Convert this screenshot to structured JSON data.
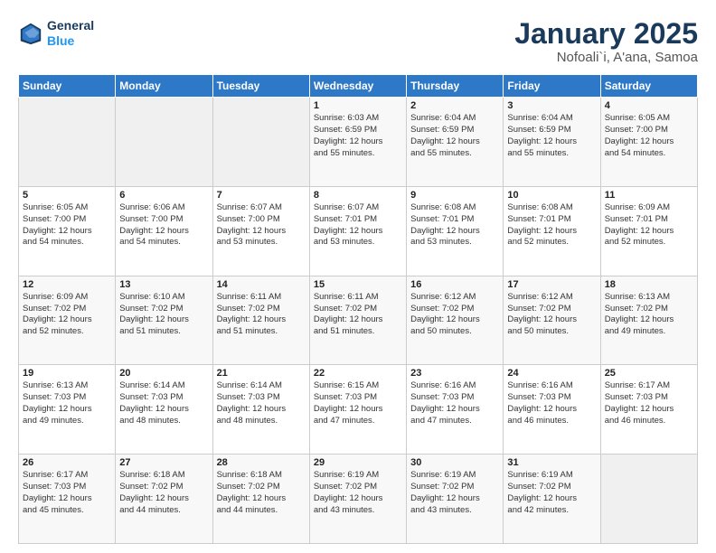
{
  "header": {
    "logo": {
      "line1": "General",
      "line2": "Blue"
    },
    "title": "January 2025",
    "subtitle": "Nofoali`i, A'ana, Samoa"
  },
  "days_of_week": [
    "Sunday",
    "Monday",
    "Tuesday",
    "Wednesday",
    "Thursday",
    "Friday",
    "Saturday"
  ],
  "weeks": [
    [
      {
        "day": "",
        "info": ""
      },
      {
        "day": "",
        "info": ""
      },
      {
        "day": "",
        "info": ""
      },
      {
        "day": "1",
        "info": "Sunrise: 6:03 AM\nSunset: 6:59 PM\nDaylight: 12 hours\nand 55 minutes."
      },
      {
        "day": "2",
        "info": "Sunrise: 6:04 AM\nSunset: 6:59 PM\nDaylight: 12 hours\nand 55 minutes."
      },
      {
        "day": "3",
        "info": "Sunrise: 6:04 AM\nSunset: 6:59 PM\nDaylight: 12 hours\nand 55 minutes."
      },
      {
        "day": "4",
        "info": "Sunrise: 6:05 AM\nSunset: 7:00 PM\nDaylight: 12 hours\nand 54 minutes."
      }
    ],
    [
      {
        "day": "5",
        "info": "Sunrise: 6:05 AM\nSunset: 7:00 PM\nDaylight: 12 hours\nand 54 minutes."
      },
      {
        "day": "6",
        "info": "Sunrise: 6:06 AM\nSunset: 7:00 PM\nDaylight: 12 hours\nand 54 minutes."
      },
      {
        "day": "7",
        "info": "Sunrise: 6:07 AM\nSunset: 7:00 PM\nDaylight: 12 hours\nand 53 minutes."
      },
      {
        "day": "8",
        "info": "Sunrise: 6:07 AM\nSunset: 7:01 PM\nDaylight: 12 hours\nand 53 minutes."
      },
      {
        "day": "9",
        "info": "Sunrise: 6:08 AM\nSunset: 7:01 PM\nDaylight: 12 hours\nand 53 minutes."
      },
      {
        "day": "10",
        "info": "Sunrise: 6:08 AM\nSunset: 7:01 PM\nDaylight: 12 hours\nand 52 minutes."
      },
      {
        "day": "11",
        "info": "Sunrise: 6:09 AM\nSunset: 7:01 PM\nDaylight: 12 hours\nand 52 minutes."
      }
    ],
    [
      {
        "day": "12",
        "info": "Sunrise: 6:09 AM\nSunset: 7:02 PM\nDaylight: 12 hours\nand 52 minutes."
      },
      {
        "day": "13",
        "info": "Sunrise: 6:10 AM\nSunset: 7:02 PM\nDaylight: 12 hours\nand 51 minutes."
      },
      {
        "day": "14",
        "info": "Sunrise: 6:11 AM\nSunset: 7:02 PM\nDaylight: 12 hours\nand 51 minutes."
      },
      {
        "day": "15",
        "info": "Sunrise: 6:11 AM\nSunset: 7:02 PM\nDaylight: 12 hours\nand 51 minutes."
      },
      {
        "day": "16",
        "info": "Sunrise: 6:12 AM\nSunset: 7:02 PM\nDaylight: 12 hours\nand 50 minutes."
      },
      {
        "day": "17",
        "info": "Sunrise: 6:12 AM\nSunset: 7:02 PM\nDaylight: 12 hours\nand 50 minutes."
      },
      {
        "day": "18",
        "info": "Sunrise: 6:13 AM\nSunset: 7:02 PM\nDaylight: 12 hours\nand 49 minutes."
      }
    ],
    [
      {
        "day": "19",
        "info": "Sunrise: 6:13 AM\nSunset: 7:03 PM\nDaylight: 12 hours\nand 49 minutes."
      },
      {
        "day": "20",
        "info": "Sunrise: 6:14 AM\nSunset: 7:03 PM\nDaylight: 12 hours\nand 48 minutes."
      },
      {
        "day": "21",
        "info": "Sunrise: 6:14 AM\nSunset: 7:03 PM\nDaylight: 12 hours\nand 48 minutes."
      },
      {
        "day": "22",
        "info": "Sunrise: 6:15 AM\nSunset: 7:03 PM\nDaylight: 12 hours\nand 47 minutes."
      },
      {
        "day": "23",
        "info": "Sunrise: 6:16 AM\nSunset: 7:03 PM\nDaylight: 12 hours\nand 47 minutes."
      },
      {
        "day": "24",
        "info": "Sunrise: 6:16 AM\nSunset: 7:03 PM\nDaylight: 12 hours\nand 46 minutes."
      },
      {
        "day": "25",
        "info": "Sunrise: 6:17 AM\nSunset: 7:03 PM\nDaylight: 12 hours\nand 46 minutes."
      }
    ],
    [
      {
        "day": "26",
        "info": "Sunrise: 6:17 AM\nSunset: 7:03 PM\nDaylight: 12 hours\nand 45 minutes."
      },
      {
        "day": "27",
        "info": "Sunrise: 6:18 AM\nSunset: 7:02 PM\nDaylight: 12 hours\nand 44 minutes."
      },
      {
        "day": "28",
        "info": "Sunrise: 6:18 AM\nSunset: 7:02 PM\nDaylight: 12 hours\nand 44 minutes."
      },
      {
        "day": "29",
        "info": "Sunrise: 6:19 AM\nSunset: 7:02 PM\nDaylight: 12 hours\nand 43 minutes."
      },
      {
        "day": "30",
        "info": "Sunrise: 6:19 AM\nSunset: 7:02 PM\nDaylight: 12 hours\nand 43 minutes."
      },
      {
        "day": "31",
        "info": "Sunrise: 6:19 AM\nSunset: 7:02 PM\nDaylight: 12 hours\nand 42 minutes."
      },
      {
        "day": "",
        "info": ""
      }
    ]
  ]
}
